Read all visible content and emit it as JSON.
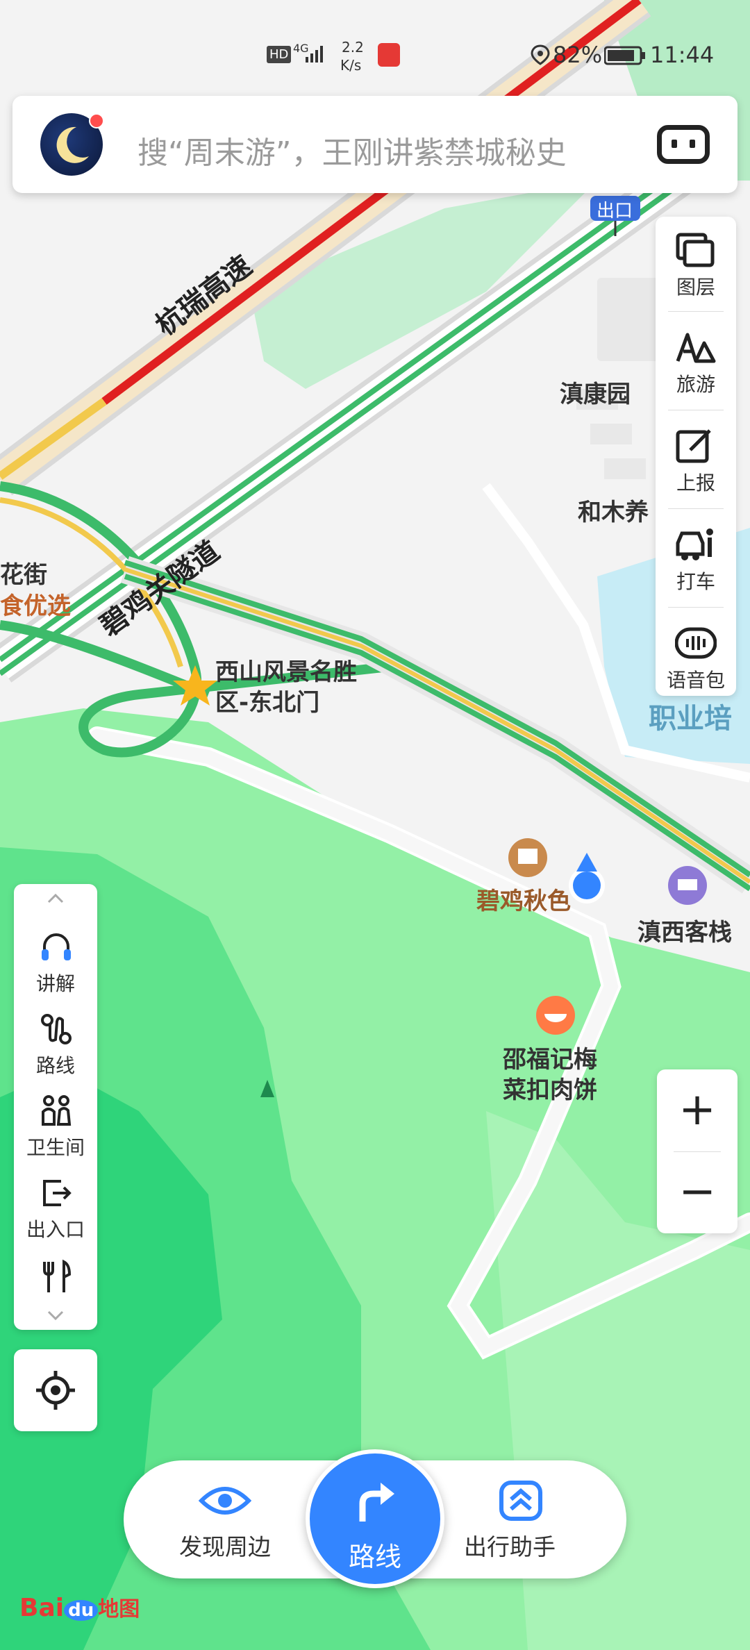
{
  "status_bar": {
    "hd": "HD",
    "network": "4G",
    "speed_value": "2.2",
    "speed_unit": "K/s",
    "battery": "82%",
    "time": "11:44",
    "icons": [
      "hd-icon",
      "signal-icon",
      "mic-icon",
      "location-icon",
      "battery-icon"
    ]
  },
  "search": {
    "placeholder": "搜“周末游”，王刚讲紫禁城秘史"
  },
  "right_panel": {
    "items": [
      {
        "label": "图层",
        "icon": "layers-icon"
      },
      {
        "label": "旅游",
        "icon": "travel-icon"
      },
      {
        "label": "上报",
        "icon": "report-icon"
      },
      {
        "label": "打车",
        "icon": "taxi-icon"
      },
      {
        "label": "语音包",
        "icon": "voice-pack-icon"
      }
    ]
  },
  "left_panel": {
    "items": [
      {
        "label": "讲解",
        "icon": "headphones-icon"
      },
      {
        "label": "路线",
        "icon": "route-icon"
      },
      {
        "label": "卫生间",
        "icon": "restroom-icon"
      },
      {
        "label": "出入口",
        "icon": "exit-icon"
      },
      {
        "label": "",
        "icon": "restaurant-icon"
      }
    ]
  },
  "zoom": {
    "in": "+",
    "out": "−"
  },
  "bottom": {
    "discover": "发现周边",
    "route": "路线",
    "assistant": "出行助手"
  },
  "logo": {
    "text": "Bai",
    "du": "du",
    "cn": "地图"
  },
  "map_labels": {
    "exit_sign": "出口",
    "highway1": "杭瑞高速",
    "highway2": "碧鸡关隧道",
    "diankang": "滇康园",
    "hemu": "和木养",
    "huajie": "花街",
    "shiyouxuan": "食优选",
    "xishan1": "西山风景名胜",
    "xishan2": "区-东北门",
    "bijiqiu": "碧鸡秋色",
    "dianxi": "滇西客栈",
    "shaofu1": "邵福记梅",
    "shaofu2": "菜扣肉饼",
    "zhiye": "职业培"
  },
  "colors": {
    "accent": "#3385ff",
    "park_green_dark": "#2fd47a",
    "park_green_light": "#93f0a6",
    "road_traffic_red": "#e02020",
    "road_green": "#3dbb6a",
    "road_yellow": "#f2c94c",
    "water": "#c7ecf6"
  }
}
